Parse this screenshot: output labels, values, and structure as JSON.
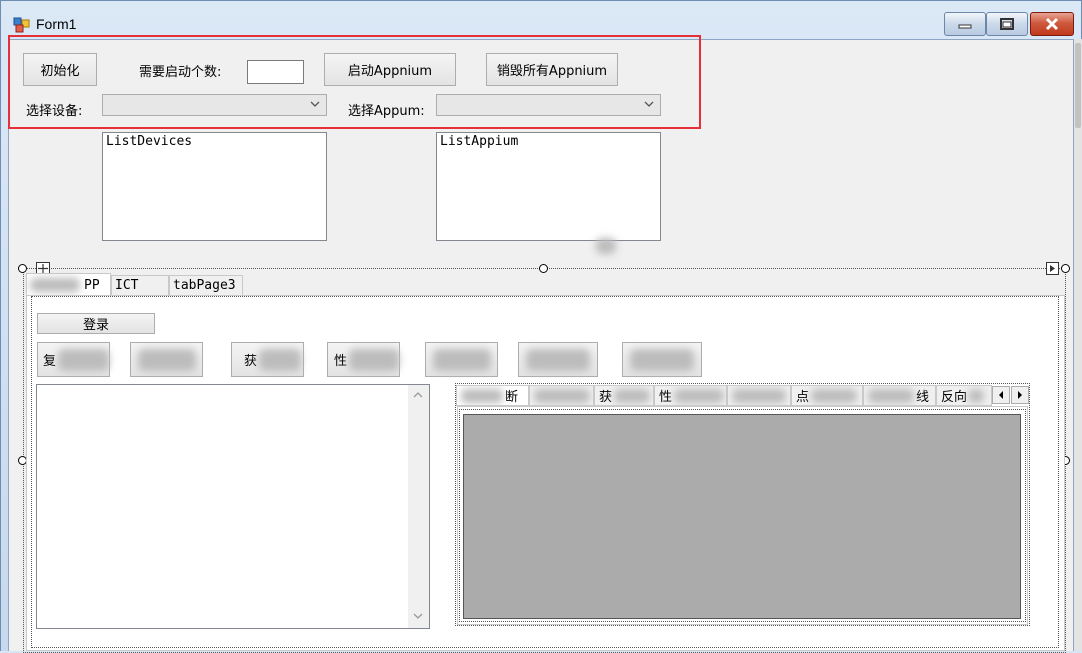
{
  "window": {
    "title": "Form1",
    "colors": {
      "close": "#c0391c",
      "highlight": "#e5303a",
      "panel": "#ababab"
    }
  },
  "top_controls": {
    "init_button": "初始化",
    "count_label": "需要启动个数:",
    "count_value": "",
    "start_appium_button": "启动Appnium",
    "destroy_appium_button": "销毁所有Appnium",
    "device_label": "选择设备:",
    "device_value": "",
    "appium_label": "选择Appum:",
    "appium_value": ""
  },
  "lists": {
    "devices": "ListDevices",
    "appium": "ListAppium"
  },
  "main_tabs": [
    "PP",
    "ICT",
    "tabPage3"
  ],
  "app_panel": {
    "login_button": "登录",
    "action_buttons": [
      "复",
      "",
      "获",
      "性",
      "",
      "",
      ""
    ]
  },
  "inner_tabs": [
    "断",
    "",
    "获",
    "性",
    "",
    "点",
    "线",
    "反向"
  ],
  "icons": [
    "app-icon",
    "minimize-icon",
    "maximize-icon",
    "close-icon",
    "chevron-down-icon",
    "scroll-up-icon",
    "scroll-down-icon",
    "tab-scroll-left-icon",
    "tab-scroll-right-icon",
    "move-handle-icon"
  ]
}
